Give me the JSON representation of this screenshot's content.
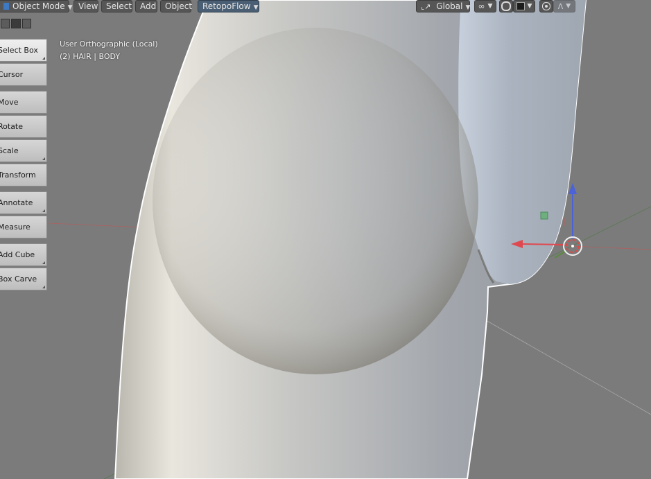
{
  "header": {
    "mode_label": "Object Mode",
    "menus": [
      "View",
      "Select",
      "Add",
      "Object"
    ],
    "addon_label": "RetopoFlow",
    "orientation_label": "Global",
    "icons": [
      "transform-orientation-icon",
      "link-icon",
      "snap-icon",
      "snap-target-icon",
      "proportional-edit-icon",
      "falloff-icon"
    ]
  },
  "toolbar": {
    "items": [
      {
        "label": "Select Box",
        "active": true
      },
      {
        "label": "Cursor"
      },
      {
        "label": "Move"
      },
      {
        "label": "Rotate"
      },
      {
        "label": "Scale"
      },
      {
        "label": "Transform"
      },
      {
        "label": "Annotate"
      },
      {
        "label": "Measure"
      },
      {
        "label": "Add Cube"
      },
      {
        "label": "Box Carve"
      }
    ]
  },
  "viewport": {
    "view_name": "User Orthographic (Local)",
    "object_info": "(2) HAIR | BODY",
    "colors": {
      "background": "#7b7b7b",
      "x_axis": "#e0484f",
      "y_axis": "#5c8a3e",
      "z_axis": "#4b63d6",
      "mesh_outline": "#ffffff"
    }
  }
}
